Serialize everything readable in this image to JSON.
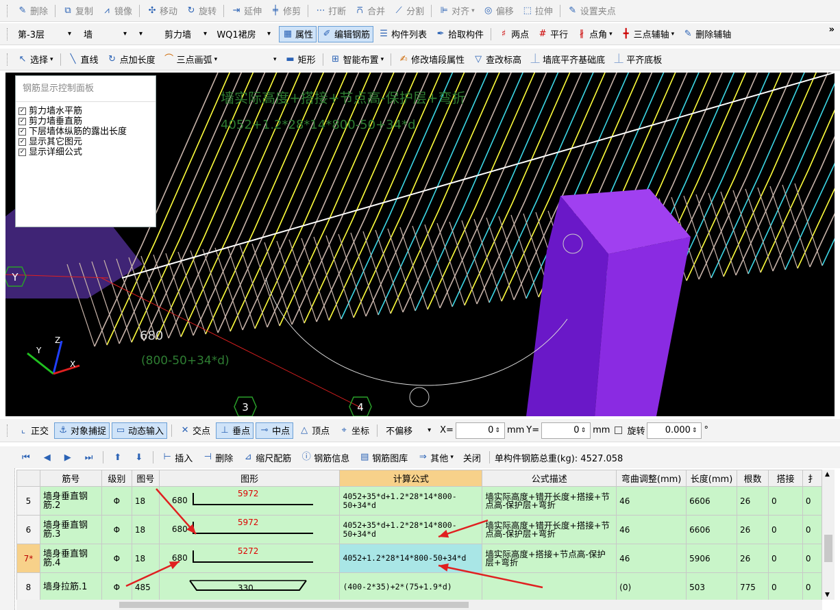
{
  "toolbar1": {
    "items": [
      "删除",
      "复制",
      "镜像",
      "移动",
      "旋转",
      "延伸",
      "修剪",
      "打断",
      "合并",
      "分割",
      "对齐",
      "偏移",
      "拉伸",
      "设置夹点"
    ]
  },
  "toolbar2": {
    "floor": "第-3层",
    "element_type": "墙",
    "wall_type": "剪力墙",
    "wall_name": "WQ1裙房",
    "props_label": "属性",
    "edit_rebar_label": "编辑钢筋",
    "component_list_label": "构件列表",
    "pick_label": "拾取构件",
    "two_point_label": "两点",
    "parallel_label": "平行",
    "point_angle_label": "点角",
    "three_point_axis_label": "三点辅轴",
    "delete_axis_label": "删除辅轴",
    "more": "»"
  },
  "toolbar3": {
    "select_label": "选择",
    "line_label": "直线",
    "point_length_label": "点加长度",
    "arc_label": "三点画弧",
    "rect_label": "矩形",
    "smart_label": "智能布置",
    "modify_wall_label": "修改墙段属性",
    "check_elev_label": "查改标高",
    "wall_foundation_label": "墙底平齐基础底",
    "slab_label": "平齐底板"
  },
  "panel": {
    "title": "钢筋显示控制面板",
    "options": [
      "剪力墙水平筋",
      "剪力墙垂直筋",
      "下层墙体纵筋的露出长度",
      "显示其它图元",
      "显示详细公式"
    ]
  },
  "viewport": {
    "text_formula_top": "墙实际高度+搭接+节点高-保护层+弯折",
    "text_value_top": "4052+1.2*28*14*800-50+34*d",
    "text_680": "680",
    "text_formula_bottom": "(800-50+34*d)",
    "axis_3": "3",
    "axis_4": "4",
    "axis_y": "Y",
    "gizmo_z": "Z",
    "gizmo_y": "Y",
    "gizmo_x": "X",
    "colors": {
      "rebar_yellow": "#ffff3c",
      "rebar_cyan": "#3cd7e6",
      "rebar_gray": "#c8b4aa",
      "column_purple": "#8a2be2",
      "text_green": "#2e7d32"
    }
  },
  "snapbar": {
    "ortho": "正交",
    "snap": "对象捕捉",
    "dynamic": "动态输入",
    "intersection": "交点",
    "perpendicular": "垂点",
    "midpoint": "中点",
    "vertex": "顶点",
    "coord": "坐标",
    "offset_mode": "不偏移",
    "x_label": "X=",
    "x_value": "0",
    "mm1": "mm",
    "y_label": "Y=",
    "y_value": "0",
    "mm2": "mm",
    "rotate_label": "旋转",
    "rotate_value": "0.000",
    "degree": "°"
  },
  "gridbar": {
    "insert": "插入",
    "delete": "删除",
    "scale": "缩尺配筋",
    "info": "钢筋信息",
    "library": "钢筋图库",
    "other": "其他",
    "close": "关闭",
    "total": "单构件钢筋总重(kg): 4527.058"
  },
  "table": {
    "headers": [
      "",
      "筋号",
      "级别",
      "图号",
      "图形",
      "计算公式",
      "公式描述",
      "弯曲调整(mm)",
      "长度(mm)",
      "根数",
      "搭接",
      "扌"
    ],
    "rows": [
      {
        "no": "5",
        "name": "墙身垂直钢筋.2",
        "grade": "Φ",
        "fig": "18",
        "left": "680",
        "mid": "5972",
        "formula": "4052+35*d+1.2*28*14*800-50+34*d",
        "desc": "墙实际高度+错开长度+搭接+节点高-保护层+弯折",
        "bend": "46",
        "length": "6606",
        "count": "26",
        "lap": "0",
        "extra": "0"
      },
      {
        "no": "6",
        "name": "墙身垂直钢筋.3",
        "grade": "Φ",
        "fig": "18",
        "left": "680",
        "mid": "5972",
        "formula": "4052+35*d+1.2*28*14*800-50+34*d",
        "desc": "墙实际高度+错开长度+搭接+节点高-保护层+弯折",
        "bend": "46",
        "length": "6606",
        "count": "26",
        "lap": "0",
        "extra": "0"
      },
      {
        "no": "7*",
        "name": "墙身垂直钢筋.4",
        "grade": "Φ",
        "fig": "18",
        "left": "680",
        "mid": "5272",
        "formula": "4052+1.2*28*14*800-50+34*d",
        "desc": "墙实际高度+搭接+节点高-保护层+弯折",
        "bend": "46",
        "length": "5906",
        "count": "26",
        "lap": "0",
        "extra": "0"
      },
      {
        "no": "8",
        "name": "墙身拉筋.1",
        "grade": "Φ",
        "fig": "485",
        "left": "",
        "mid": "330",
        "formula": "(400-2*35)+2*(75+1.9*d)",
        "desc": "",
        "bend": "(0)",
        "length": "503",
        "count": "775",
        "lap": "0",
        "extra": "0"
      }
    ]
  }
}
